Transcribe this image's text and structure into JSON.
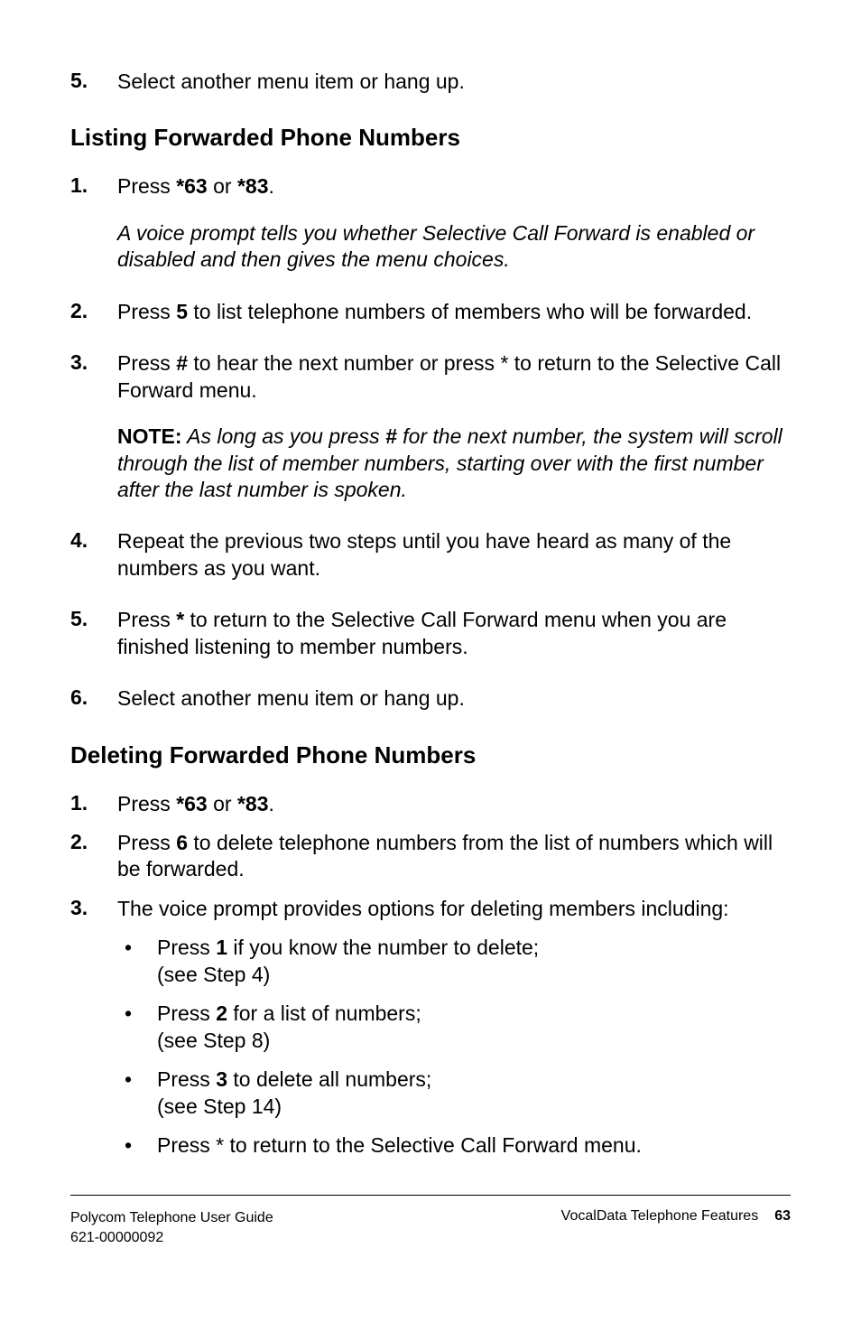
{
  "top_item": {
    "num": "5.",
    "text_a": "Select another menu item or hang up."
  },
  "section1": {
    "heading": "Listing Forwarded Phone Numbers",
    "items": [
      {
        "num": "1.",
        "p1_a": "Press ",
        "p1_b": "*63",
        "p1_c": " or ",
        "p1_d": "*83",
        "p1_e": ".",
        "p2": "A voice prompt tells you whether Selective Call Forward is enabled or disabled and then gives the menu choices."
      },
      {
        "num": "2.",
        "p1_a": "Press ",
        "p1_b": "5",
        "p1_c": " to list telephone numbers of members who will be forwarded."
      },
      {
        "num": "3.",
        "p1_a": "Press ",
        "p1_b": "#",
        "p1_c": " to hear the next number or press * to return to the Selective Call Forward menu.",
        "p2_a": "NOTE:",
        "p2_b": " As long as you press ",
        "p2_c": "#",
        "p2_d": " for the next number, the system will scroll through the list of member numbers, starting over with the first number after the last number is spoken."
      },
      {
        "num": "4.",
        "p1": "Repeat the previous two steps until you have heard as many of the numbers as you want."
      },
      {
        "num": "5.",
        "p1_a": "Press ",
        "p1_b": "*",
        "p1_c": " to return to the Selective Call Forward menu when you are finished listening to member numbers."
      },
      {
        "num": "6.",
        "p1": "Select another menu item or hang up."
      }
    ]
  },
  "section2": {
    "heading": "Deleting Forwarded Phone Numbers",
    "items": [
      {
        "num": "1.",
        "p1_a": "Press ",
        "p1_b": "*63",
        "p1_c": " or ",
        "p1_d": "*83",
        "p1_e": "."
      },
      {
        "num": "2.",
        "p1_a": "Press ",
        "p1_b": "6",
        "p1_c": " to delete telephone numbers from the list of numbers which will be forwarded."
      },
      {
        "num": "3.",
        "p1": "The voice prompt provides options for deleting members including:",
        "bullets": [
          {
            "l1_a": "Press ",
            "l1_b": "1",
            "l1_c": " if you know the number to delete;",
            "l2": "(see Step 4)"
          },
          {
            "l1_a": "Press ",
            "l1_b": "2",
            "l1_c": " for a list of numbers;",
            "l2": "(see Step 8)"
          },
          {
            "l1_a": "Press ",
            "l1_b": "3",
            "l1_c": " to delete all numbers;",
            "l2": "(see Step 14)"
          },
          {
            "l1": "Press * to return to the Selective Call Forward menu."
          }
        ]
      }
    ]
  },
  "footer": {
    "left1": "Polycom Telephone User Guide",
    "left2": "621-00000092",
    "right": "VocalData Telephone Features",
    "page": "63"
  }
}
